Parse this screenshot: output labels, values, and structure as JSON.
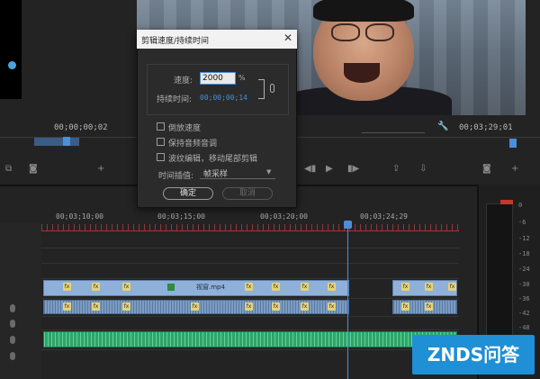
{
  "source_monitor": {
    "timecode": "00;00;00;02"
  },
  "program_monitor": {
    "timecode_left": "00;03;29;01"
  },
  "dialog": {
    "title": "剪辑速度/持续时间",
    "close_glyph": "✕",
    "speed_label": "速度:",
    "speed_value": "2000",
    "speed_unit": "%",
    "duration_label": "持续时间:",
    "duration_value": "00;00;00;14",
    "options": [
      {
        "label": "倒放速度",
        "checked": false
      },
      {
        "label": "保持音频音调",
        "checked": false
      },
      {
        "label": "波纹编辑，移动尾部剪辑",
        "checked": false
      }
    ],
    "interpolation_label": "时间插值:",
    "interpolation_value": "帧采样",
    "ok_label": "确定",
    "cancel_label": "取消"
  },
  "timeline": {
    "ruler_labels": [
      "00;03;10;00",
      "00;03;15;00",
      "00;03;20;00",
      "00;03;24;29"
    ],
    "clip_name": "视窗.mp4",
    "fx_badge_text": "fx"
  },
  "audio_meter": {
    "db_labels": [
      "0",
      "-6",
      "-12",
      "-18",
      "-24",
      "-30",
      "-36",
      "-42",
      "-48"
    ]
  },
  "watermark": {
    "text": "ZNDS问答"
  },
  "colors": {
    "accent_blue": "#4a8fd8",
    "video_clip": "#8fb0d8",
    "audio_clip": "#2fa36a",
    "watermark_blue": "#1f8fd6"
  }
}
